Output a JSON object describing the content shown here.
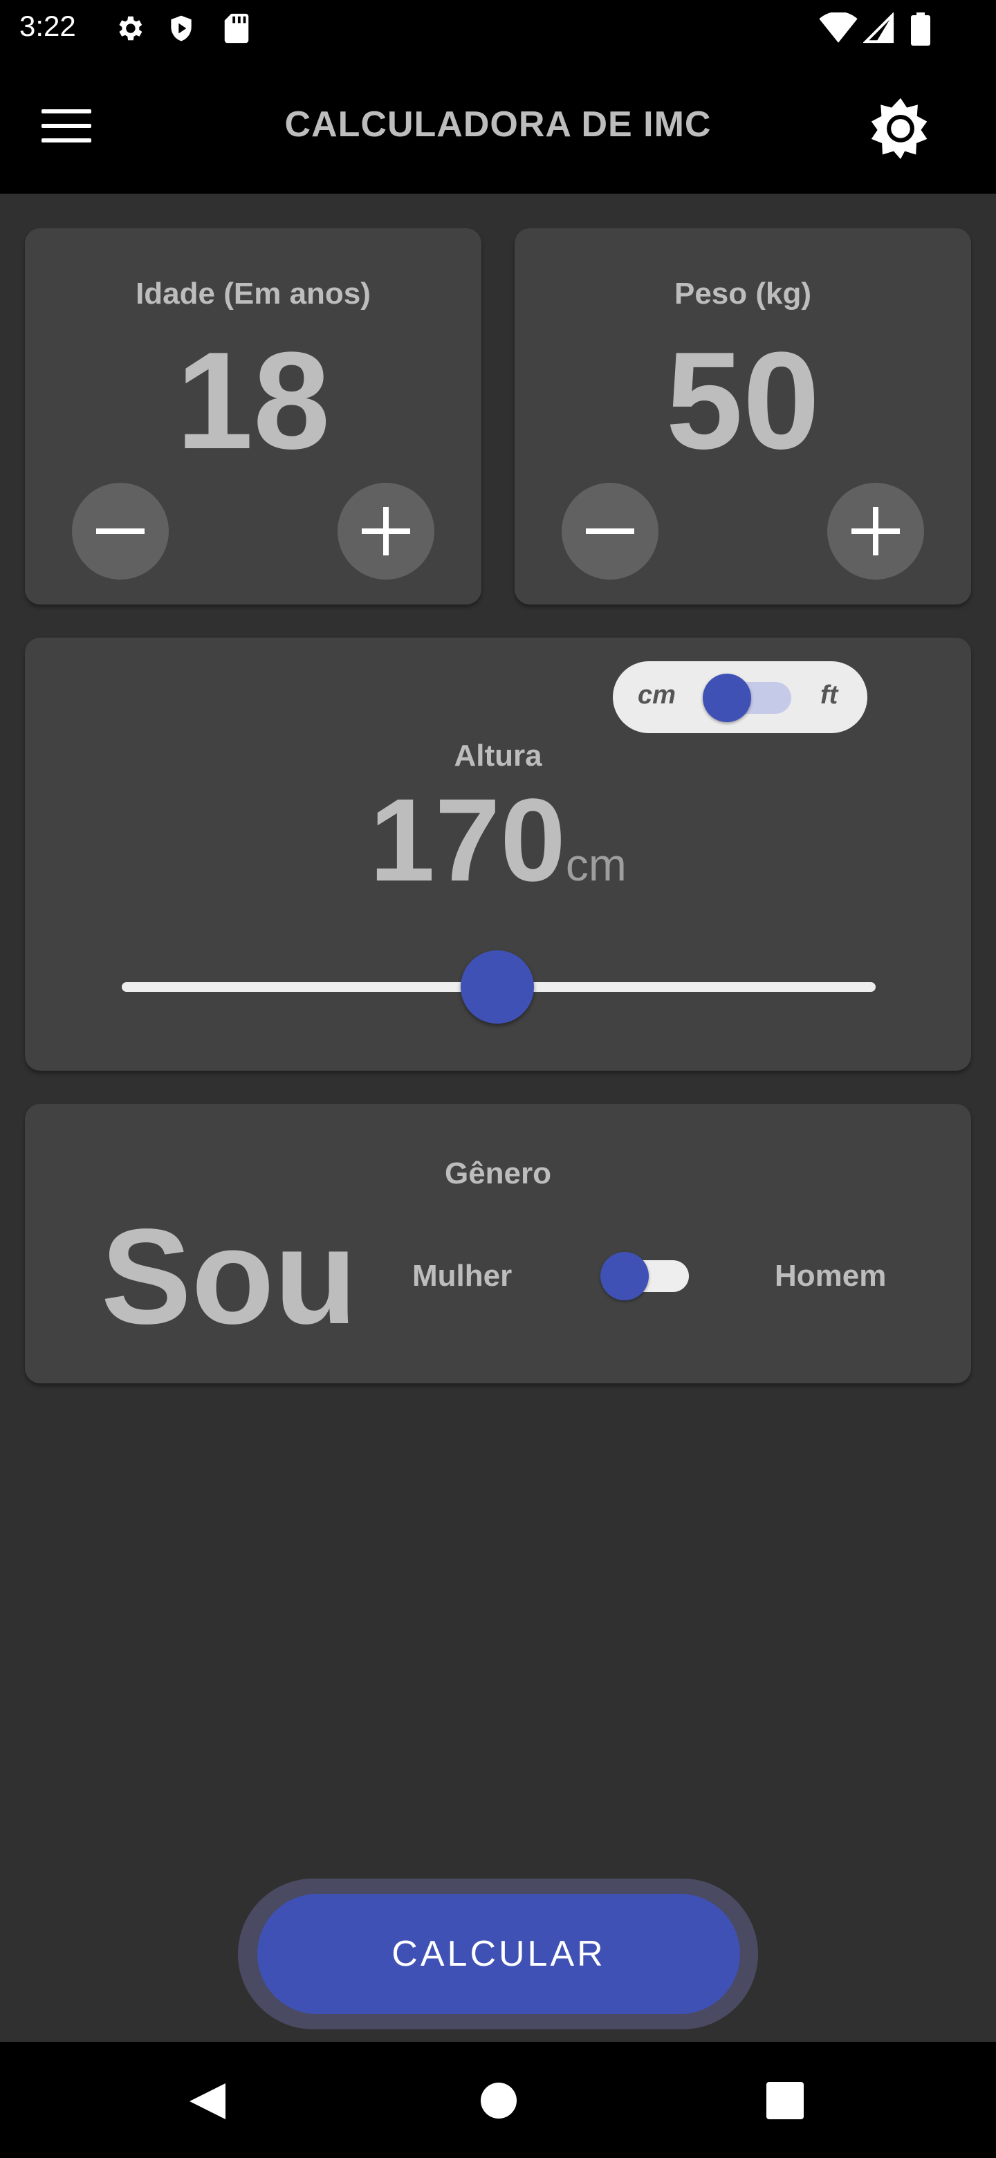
{
  "status_bar": {
    "time": "3:22"
  },
  "app_bar": {
    "title": "CALCULADORA DE IMC"
  },
  "age_card": {
    "label": "Idade (Em anos)",
    "value": "18"
  },
  "weight_card": {
    "label": "Peso (kg)",
    "value": "50"
  },
  "height_card": {
    "unit_toggle": {
      "left_label": "cm",
      "right_label": "ft",
      "selected": "cm"
    },
    "label": "Altura",
    "value": "170",
    "unit": "cm",
    "slider_fraction": 0.5
  },
  "gender_card": {
    "label": "Gênero",
    "big_text": "Sou",
    "left_label": "Mulher",
    "right_label": "Homem",
    "selected": "Mulher"
  },
  "calculate_button": {
    "label": "CALCULAR"
  },
  "colors": {
    "accent": "#3f51b5",
    "card": "#424242",
    "background": "#303030",
    "text": "#bdbdbd"
  }
}
